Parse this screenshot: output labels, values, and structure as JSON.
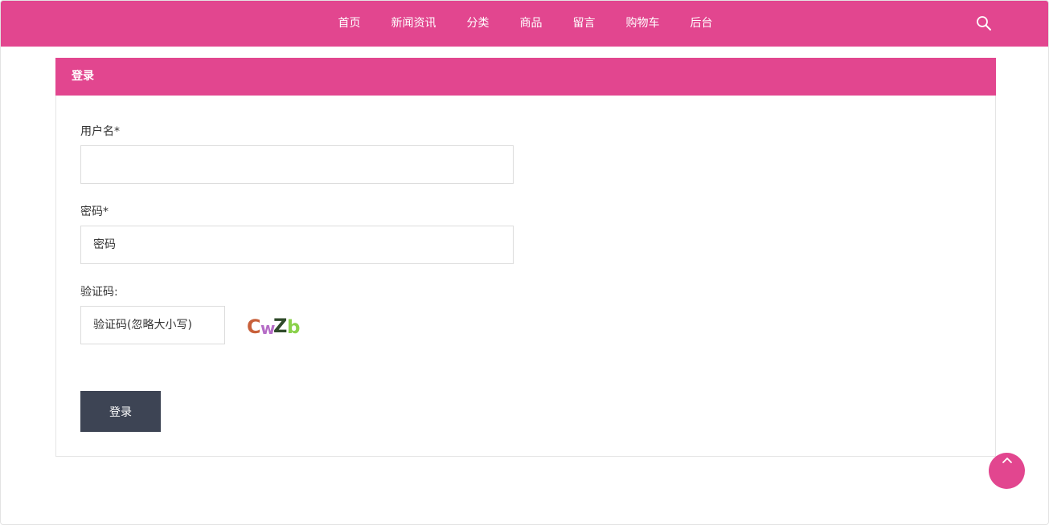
{
  "nav": {
    "items": [
      {
        "label": "首页"
      },
      {
        "label": "新闻资讯"
      },
      {
        "label": "分类"
      },
      {
        "label": "商品"
      },
      {
        "label": "留言"
      },
      {
        "label": "购物车"
      },
      {
        "label": "后台"
      }
    ],
    "search_icon": "search-icon"
  },
  "login": {
    "title": "登录",
    "username_label": "用户名*",
    "username_value": "",
    "username_placeholder": "",
    "password_label": "密码*",
    "password_placeholder": "密码",
    "captcha_label": "验证码:",
    "captcha_placeholder": "验证码(忽略大小写)",
    "captcha_text": [
      "C",
      "w",
      "Z",
      "b"
    ],
    "captcha_colors": [
      "#c8603a",
      "#b56cc6",
      "#2f4a2a",
      "#8ad14b"
    ],
    "submit_label": "登录"
  },
  "colors": {
    "brand": "#e2468f",
    "button_dark": "#3d4454"
  },
  "back_to_top_icon": "chevron-up-icon"
}
